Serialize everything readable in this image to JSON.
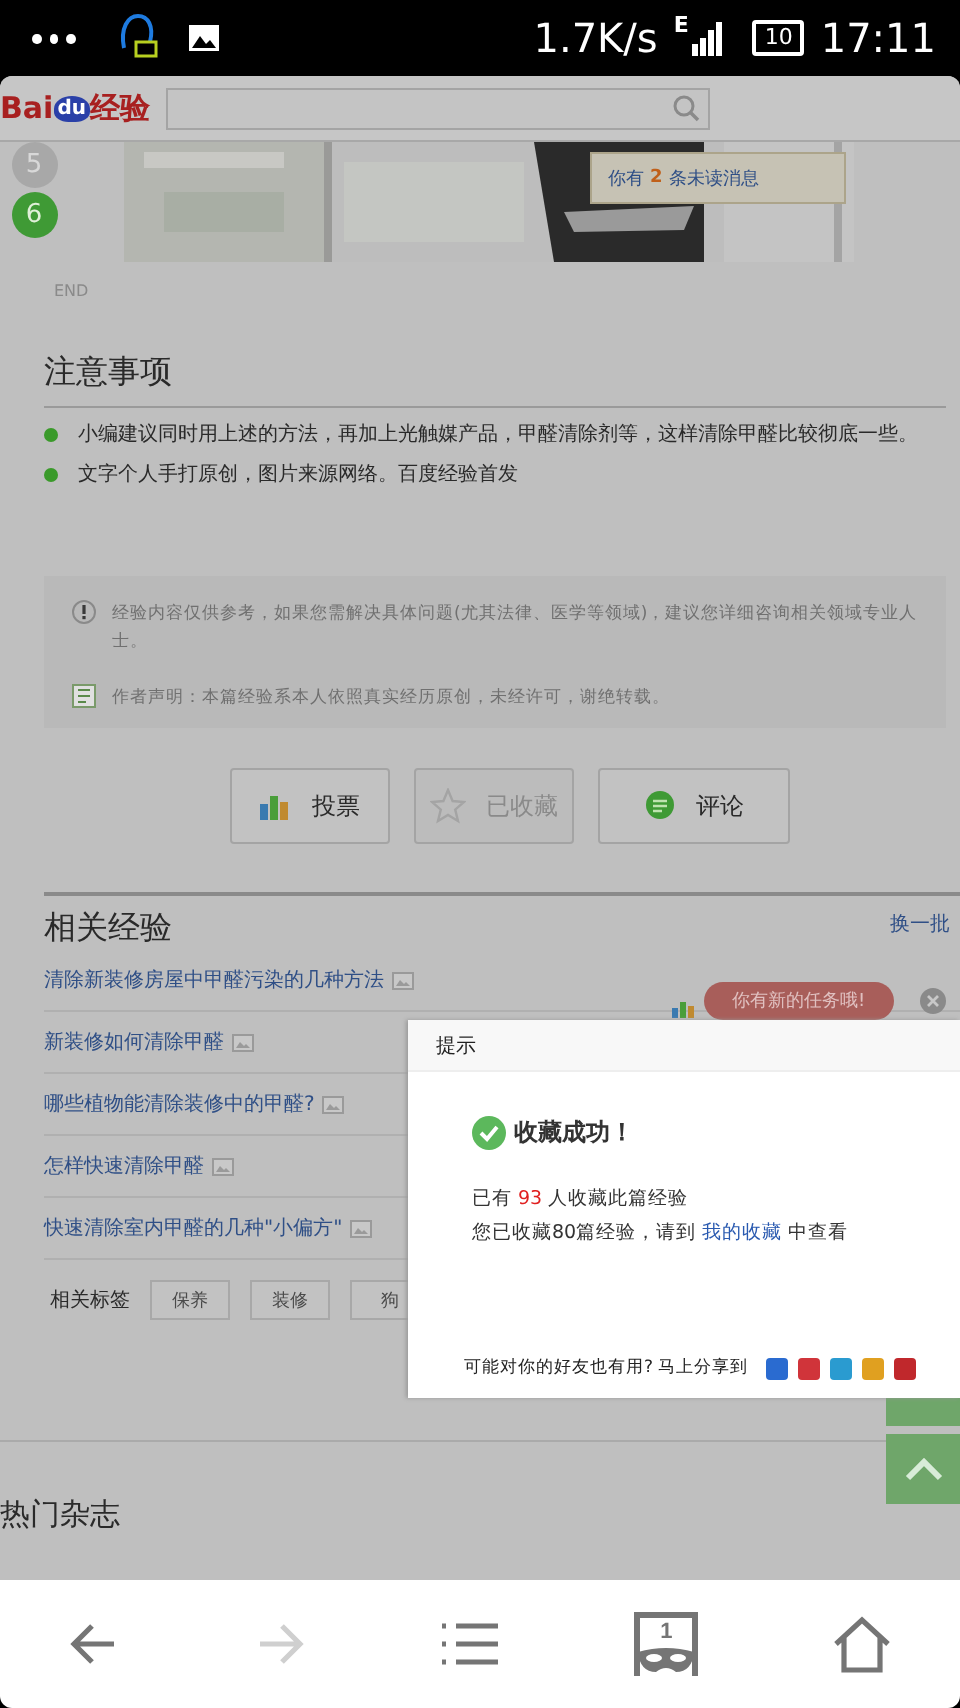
{
  "status_bar": {
    "speed": "1.7K/s",
    "network": "E",
    "battery": "10",
    "time": "17:11"
  },
  "header": {
    "logo": [
      "Bai",
      "du",
      "经验"
    ]
  },
  "steps": [
    {
      "number": "5",
      "selected": false
    },
    {
      "number": "6",
      "selected": true
    }
  ],
  "notice": {
    "prefix": "你有",
    "count": "2",
    "suffix": "条未读消息"
  },
  "end_label": "END",
  "notes": {
    "title": "注意事项",
    "items": [
      "小编建议同时用上述的方法，再加上光触媒产品，甲醛清除剂等，这样清除甲醛比较彻底一些。",
      "文字个人手打原创，图片来源网络。百度经验首发"
    ]
  },
  "disclaimer": [
    {
      "kind": "warning",
      "text": "经验内容仅供参考，如果您需解决具体问题(尤其法律、医学等领域)，建议您详细咨询相关领域专业人士。"
    },
    {
      "kind": "original",
      "text": "作者声明：本篇经验系本人依照真实经历原创，未经许可，谢绝转载。"
    }
  ],
  "actions": [
    {
      "kind": "vote",
      "label": "投票",
      "disabled": false
    },
    {
      "kind": "favorite",
      "label": "已收藏",
      "disabled": true
    },
    {
      "kind": "comment",
      "label": "评论",
      "disabled": false
    }
  ],
  "related": {
    "title": "相关经验",
    "refresh": "换一批",
    "links": [
      {
        "text": "清除新装修房屋中甲醛污染的几种方法",
        "has_image": true
      },
      {
        "text": "新装修如何清除甲醛",
        "has_image": true
      },
      {
        "text": "哪些植物能清除装修中的甲醛?",
        "has_image": true
      },
      {
        "text": "怎样快速清除甲醛",
        "has_image": true
      },
      {
        "text": "快速清除室内甲醛的几种\"小偏方\"",
        "has_image": true
      }
    ],
    "tags_label": "相关标签",
    "tags": [
      "保养",
      "装修",
      "狗"
    ]
  },
  "task_bubble": "你有新的任务哦!",
  "dialog": {
    "title": "提示",
    "headline": "收藏成功！",
    "line_1": {
      "prefix": "已有",
      "count": "93",
      "suffix": "人收藏此篇经验"
    },
    "line_2": {
      "prefix": "您已收藏80篇经验，请到",
      "link": "我的收藏",
      "suffix": "中查看"
    },
    "share_label": "可能对你的好友也有用? 马上分享到"
  },
  "hot": {
    "title": "热门杂志"
  },
  "bottom_nav": [
    {
      "kind": "back",
      "disabled": false
    },
    {
      "kind": "forward",
      "disabled": true
    },
    {
      "kind": "menu",
      "disabled": false
    },
    {
      "kind": "tabs",
      "count": "1",
      "disabled": false
    },
    {
      "kind": "home",
      "disabled": false
    }
  ]
}
